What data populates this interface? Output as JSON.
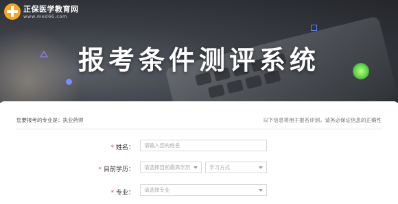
{
  "header": {
    "logo_name": "正保医学教育网",
    "logo_url": "www.med66.com",
    "title": "报考条件测评系统"
  },
  "form": {
    "major_label": "您要报考的专业是：执业药师",
    "info_note": "以下信息将用于报名评测，请务必保证信息的正确性",
    "fields": {
      "name": {
        "label": "姓名：",
        "required_mark": "*",
        "placeholder": "请输入您的姓名"
      },
      "education": {
        "label": "目前学历：",
        "required_mark": "*",
        "degree_placeholder": "请选择目前最高学历",
        "study_mode_placeholder": "学习方式"
      },
      "major": {
        "label": "专业：",
        "required_mark": "*",
        "placeholder": "请选择专业"
      }
    }
  },
  "colors": {
    "required": "#e43d3d",
    "accent_blue": "#5b7fff",
    "accent_green": "#5fd44a",
    "logo_orange": "#f5a623"
  }
}
